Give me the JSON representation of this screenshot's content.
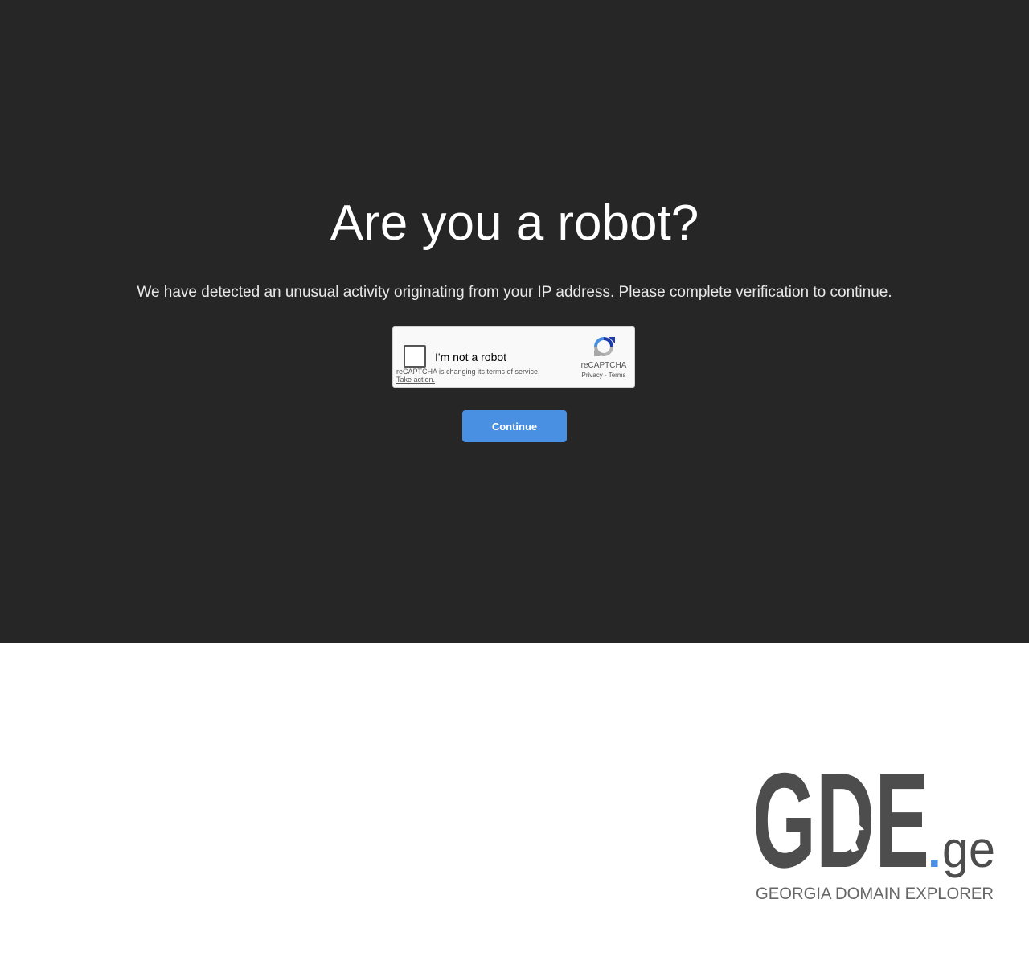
{
  "page": {
    "title": "Are you a robot?",
    "message": "We have detected an unusual activity originating from your IP address. Please complete verification to continue."
  },
  "recaptcha": {
    "label": "I'm not a robot",
    "notice": "reCAPTCHA is changing its terms of service.",
    "notice_link": "Take action.",
    "brand": "reCAPTCHA",
    "privacy_link": "Privacy",
    "separator": "-",
    "terms_link": "Terms",
    "checked": false
  },
  "actions": {
    "continue_label": "Continue"
  },
  "logo": {
    "letters_main": "GDE",
    "dot": ".",
    "tld": "ge",
    "tagline": "GEORGIA DOMAIN EXPLORER"
  },
  "colors": {
    "dark_background": "#262626",
    "button": "#4a90e2",
    "logo_gray": "#4d4d4d",
    "logo_dot": "#4a90e2"
  },
  "icons": [
    "recaptcha-logo-icon",
    "cursor-arrow-icon"
  ]
}
